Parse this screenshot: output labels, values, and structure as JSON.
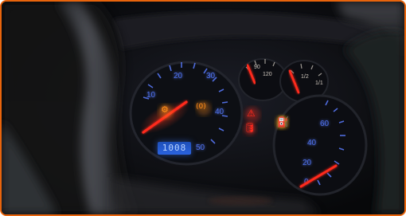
{
  "image": {
    "border_color": "#e8640c",
    "accent_amber": "#ff8c1a",
    "accent_red": "#ff2a1f",
    "accent_blue": "#5b7cff"
  },
  "speedometer": {
    "tick_labels": [
      "20",
      "30",
      "40",
      "50",
      "10"
    ]
  },
  "temperature_gauge": {
    "tick_labels": [
      "90",
      "120"
    ]
  },
  "fuel_gauge": {
    "tick_labels": [
      "1/2",
      "1/1"
    ]
  },
  "tachometer": {
    "tick_labels": [
      "60",
      "40",
      "20",
      "0"
    ]
  },
  "odometer": {
    "value": "1008"
  },
  "warning_lights": [
    {
      "name": "coolant-temperature-icon",
      "glyph": "⚠",
      "color": "#ff2a1f"
    },
    {
      "name": "oil-pressure-icon",
      "glyph": "🛢",
      "color": "#ff2a1f"
    },
    {
      "name": "brake-pads-icon",
      "glyph": "(0)",
      "color": "#ff8c1a"
    },
    {
      "name": "fuel-reserve-icon",
      "glyph": "⛽",
      "color": "#ffb020"
    },
    {
      "name": "engine-check-icon",
      "glyph": "⚙",
      "color": "#ff8c1a"
    }
  ]
}
